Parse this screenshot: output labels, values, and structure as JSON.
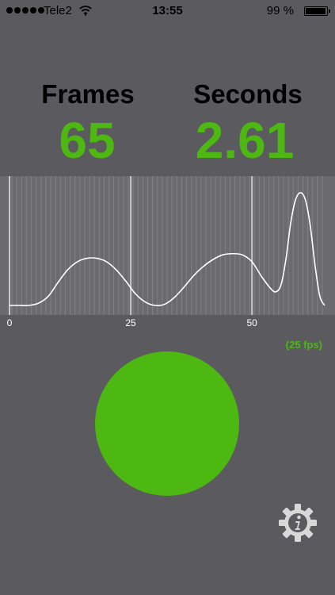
{
  "status_bar": {
    "carrier": "Tele2",
    "time": "13:55",
    "battery_percent": "99 %",
    "battery_level": 0.99,
    "signal_bars": 5
  },
  "stats": {
    "frames_label": "Frames",
    "frames_value": "65",
    "seconds_label": "Seconds",
    "seconds_value": "2.61"
  },
  "fps_label": "(25 fps)",
  "colors": {
    "accent": "#4db812",
    "background": "#5a5a5f",
    "graph_bg": "#6b6b6f"
  },
  "chart_data": {
    "type": "line",
    "x_ticks": [
      "0",
      "25",
      "50"
    ],
    "xlim": [
      0,
      65
    ],
    "ylim": [
      0,
      1
    ],
    "major_gridlines": [
      0,
      25,
      50
    ],
    "minor_gridline_count": 65,
    "x": [
      0,
      2,
      4,
      6,
      8,
      10,
      12,
      14,
      16,
      18,
      20,
      22,
      24,
      26,
      28,
      30,
      32,
      34,
      36,
      38,
      40,
      42,
      44,
      46,
      48,
      50,
      52,
      54,
      55,
      56,
      57,
      58,
      59,
      60,
      61,
      62,
      63,
      64,
      65
    ],
    "values": [
      0.0,
      0.0,
      0.0,
      0.02,
      0.08,
      0.2,
      0.31,
      0.38,
      0.41,
      0.41,
      0.38,
      0.31,
      0.21,
      0.1,
      0.03,
      0.0,
      0.01,
      0.07,
      0.16,
      0.26,
      0.34,
      0.4,
      0.44,
      0.45,
      0.44,
      0.38,
      0.25,
      0.14,
      0.12,
      0.18,
      0.4,
      0.72,
      0.92,
      0.98,
      0.92,
      0.7,
      0.35,
      0.08,
      0.0
    ]
  },
  "icons": {
    "settings": "gear-info-icon",
    "wifi": "wifi-icon"
  }
}
